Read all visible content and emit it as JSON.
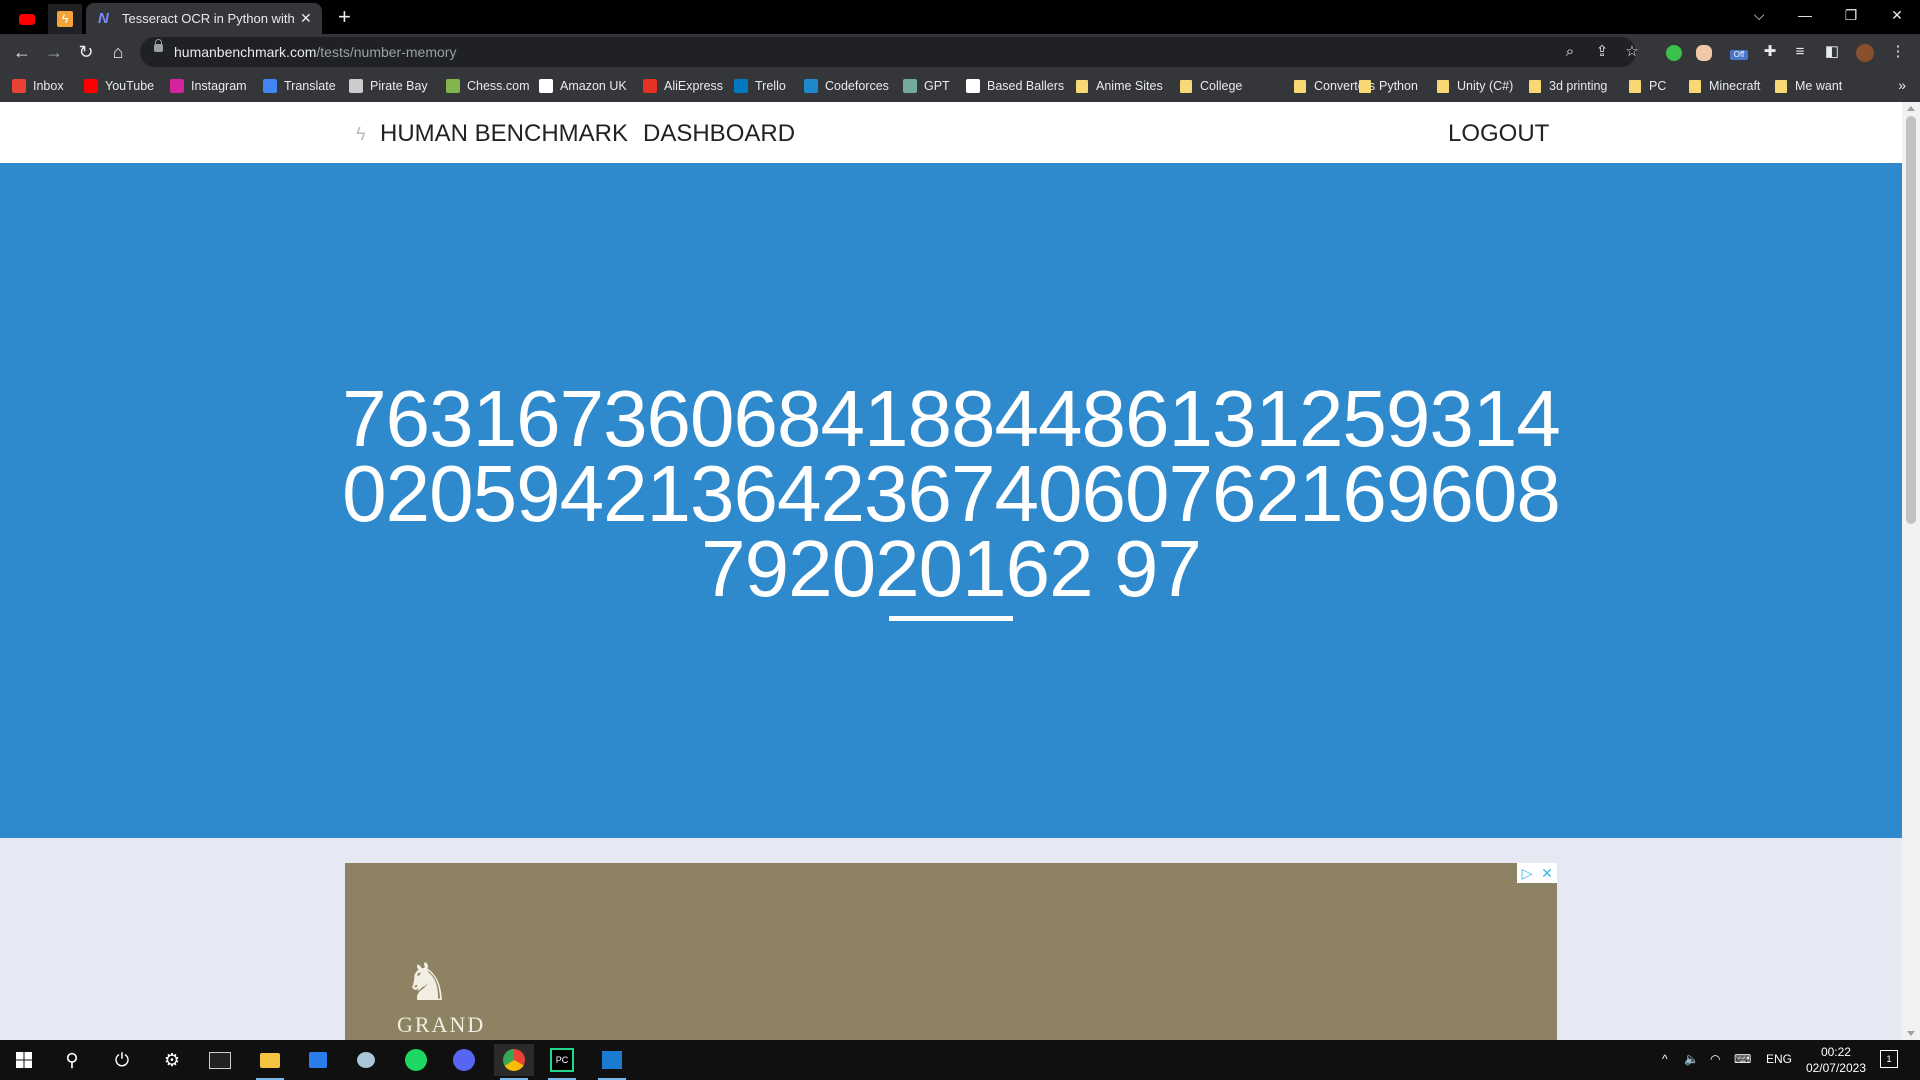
{
  "browser": {
    "active_tab_title": "Tesseract OCR in Python with Py",
    "url_host": "humanbenchmark.com",
    "url_path": "/tests/number-memory",
    "bookmarks": [
      {
        "label": "Inbox",
        "icon": "gmail-icon",
        "color": "#ea4335"
      },
      {
        "label": "YouTube",
        "icon": "youtube-icon",
        "color": "#ff0000"
      },
      {
        "label": "Instagram",
        "icon": "instagram-icon",
        "color": "#d6249f"
      },
      {
        "label": "Translate",
        "icon": "translate-icon",
        "color": "#4285f4"
      },
      {
        "label": "Pirate Bay",
        "icon": "pirate-bay-icon",
        "color": "#cccccc"
      },
      {
        "label": "Chess.com",
        "icon": "chess-icon",
        "color": "#81b64c"
      },
      {
        "label": "Amazon UK",
        "icon": "amazon-icon",
        "color": "#ffffff"
      },
      {
        "label": "AliExpress",
        "icon": "aliexpress-icon",
        "color": "#e43225"
      },
      {
        "label": "Trello",
        "icon": "trello-icon",
        "color": "#0079bf"
      },
      {
        "label": "Codeforces",
        "icon": "codeforces-icon",
        "color": "#1f8acb"
      },
      {
        "label": "GPT",
        "icon": "openai-icon",
        "color": "#74aa9c"
      },
      {
        "label": "Based Ballers",
        "icon": "w-icon",
        "color": "#ffffff"
      },
      {
        "label": "Anime Sites",
        "icon": "folder-icon"
      },
      {
        "label": "College",
        "icon": "folder-icon"
      },
      {
        "label": "Converters",
        "icon": "folder-icon"
      },
      {
        "label": "Python",
        "icon": "folder-icon"
      },
      {
        "label": "Unity (C#)",
        "icon": "folder-icon"
      },
      {
        "label": "3d printing",
        "icon": "folder-icon"
      },
      {
        "label": "PC",
        "icon": "folder-icon"
      },
      {
        "label": "Minecraft",
        "icon": "folder-icon"
      },
      {
        "label": "Me want",
        "icon": "folder-icon"
      }
    ],
    "more": "»",
    "ext_badge": "Off"
  },
  "site": {
    "brand": "HUMAN BENCHMARK",
    "dashboard": "DASHBOARD",
    "logout": "LOGOUT"
  },
  "test": {
    "number": "76316736068418844861312593140205942136423674060762169608792020162 97",
    "timer_remaining_fraction": 1.0
  },
  "ad": {
    "brand_text": "GRAND"
  },
  "taskbar": {
    "lang": "ENG",
    "time": "00:22",
    "date": "02/07/2023",
    "notifications": "1"
  },
  "colors": {
    "hero": "#2e89cd",
    "lower": "#e6e8f4",
    "ad": "#8d8262"
  }
}
